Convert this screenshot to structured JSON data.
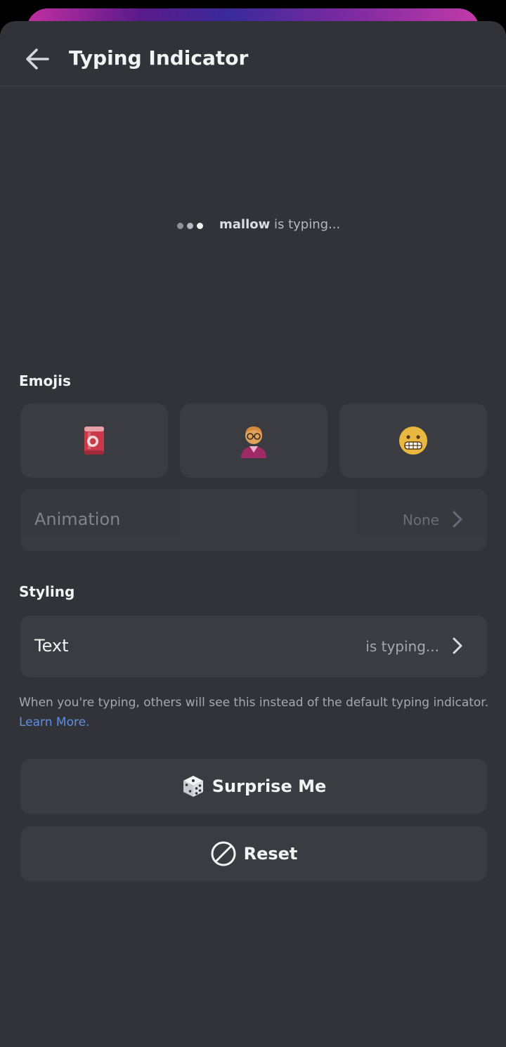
{
  "header": {
    "title": "Typing Indicator",
    "back_icon": "arrow-left-icon"
  },
  "preview": {
    "username": "mallow",
    "typing_text": "is typing..."
  },
  "emojis_section": {
    "title": "Emojis",
    "items": [
      {
        "icon": "soda-can-emoji-icon"
      },
      {
        "icon": "person-with-glasses-emoji-icon"
      },
      {
        "icon": "grimacing-face-emoji-icon"
      }
    ]
  },
  "animation_row": {
    "label": "Animation",
    "value": "None"
  },
  "styling_section": {
    "title": "Styling"
  },
  "text_row": {
    "label": "Text",
    "value": "is typing..."
  },
  "help": {
    "text": "When you're typing, others will see this instead of the default typing indicator.",
    "link": "Learn More."
  },
  "buttons": {
    "surprise": {
      "label": "Surprise Me",
      "icon": "dice-icon"
    },
    "reset": {
      "label": "Reset",
      "icon": "prohibited-icon"
    }
  },
  "colors": {
    "background": "#323339",
    "surface": "#3b3c42",
    "link": "#5e8fe0"
  }
}
